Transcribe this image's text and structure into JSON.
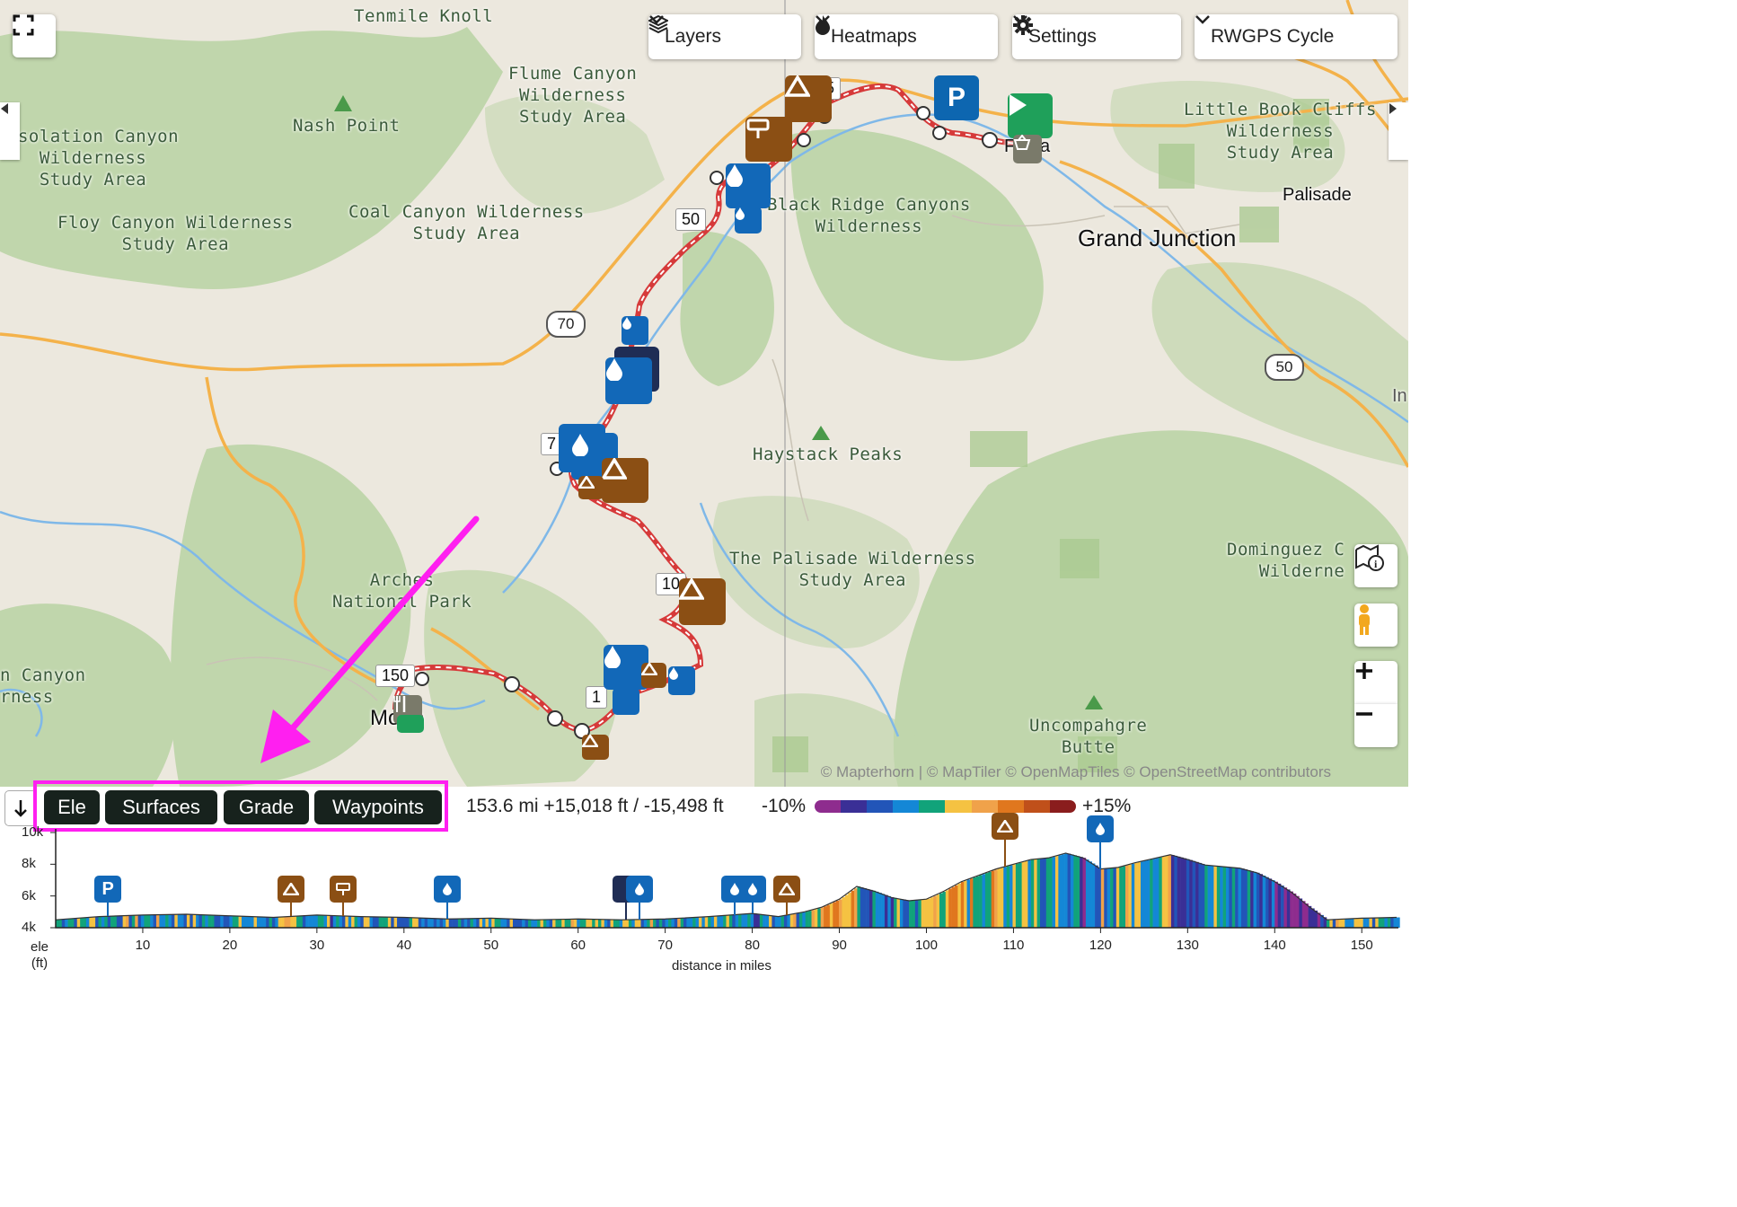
{
  "toolbar": {
    "layers_label": "Layers",
    "heatmaps_label": "Heatmaps",
    "settings_label": "Settings",
    "basemap_label": "RWGPS Cycle"
  },
  "map_labels": {
    "tenmile": "Tenmile Knoll",
    "flume": "Flume Canyon\nWilderness\nStudy Area",
    "nash": "Nash Point",
    "desolation": "esolation Canyon\nWilderness\nStudy Area",
    "floy": "Floy Canyon Wilderness\nStudy Area",
    "coal": "Coal Canyon Wilderness\nStudy Area",
    "blackridge": "Black Ridge Canyons\nWilderness",
    "littlebook": "Little Book Cliffs\nWilderness\nStudy Area",
    "palisade": "Palisade",
    "grandjunction": "Grand Junction",
    "haystack": "Haystack Peaks",
    "palisadewild": "The Palisade Wilderness\nStudy Area",
    "dominguez": "Dominguez C\nWilderne",
    "arches": "Arches\nNational Park",
    "canyon": "n Canyon\nrness",
    "uncompahgre": "Uncompahgre\nButte",
    "moab": "Moab",
    "fruita": "Fruita",
    "in": "In"
  },
  "shields": {
    "i70": "70",
    "us50": "50"
  },
  "mile_markers": {
    "m50": "50",
    "m75": "7",
    "m100": "10",
    "m150": "150",
    "m125": "1",
    "m25": "5"
  },
  "attribution": "© Mapterhorn | © MapTiler © OpenMapTiles © OpenStreetMap contributors",
  "tabs": {
    "ele": "Ele",
    "surfaces": "Surfaces",
    "grade": "Grade",
    "waypoints": "Waypoints"
  },
  "stats": "153.6 mi +15,018 ft / -15,498 ft",
  "grade_legend": {
    "min": "-10%",
    "max": "+15%",
    "colors": [
      "#8e2c8e",
      "#3a2f96",
      "#2255b8",
      "#1487d6",
      "#11a37a",
      "#f5c242",
      "#f0a24a",
      "#e0771e",
      "#c0501a",
      "#8a1d1d"
    ]
  },
  "chart_data": {
    "type": "area",
    "title": "",
    "xlabel": "distance in miles",
    "ylabel": "ele\n(ft)",
    "xlim": [
      0,
      154
    ],
    "ylim": [
      4000,
      10000
    ],
    "x_ticks": [
      "10",
      "20",
      "30",
      "40",
      "50",
      "60",
      "70",
      "80",
      "90",
      "100",
      "110",
      "120",
      "130",
      "140",
      "150"
    ],
    "y_ticks": [
      "10k",
      "8k",
      "6k",
      "4k"
    ],
    "x": [
      0,
      5,
      10,
      15,
      20,
      25,
      30,
      35,
      40,
      45,
      50,
      55,
      60,
      65,
      70,
      75,
      80,
      83,
      86,
      88,
      90,
      92,
      94,
      96,
      98,
      100,
      102,
      104,
      106,
      108,
      110,
      112,
      114,
      116,
      118,
      120,
      122,
      124,
      126,
      128,
      130,
      132,
      134,
      136,
      138,
      140,
      142,
      144,
      146,
      150,
      154
    ],
    "y": [
      4500,
      4700,
      4800,
      4850,
      4750,
      4650,
      4800,
      4700,
      4650,
      4550,
      4600,
      4500,
      4550,
      4500,
      4550,
      4700,
      4900,
      4700,
      5000,
      5300,
      5800,
      6600,
      6300,
      5900,
      5700,
      5800,
      6300,
      6900,
      7300,
      7700,
      8000,
      8300,
      8400,
      8700,
      8400,
      7700,
      7800,
      8100,
      8350,
      8600,
      8300,
      7950,
      7850,
      7750,
      7450,
      6900,
      6200,
      5300,
      4500,
      4600,
      4650
    ],
    "waypoints": [
      {
        "mile": 6,
        "icon": "parking"
      },
      {
        "mile": 27,
        "icon": "camping"
      },
      {
        "mile": 33,
        "icon": "sign"
      },
      {
        "mile": 45,
        "icon": "water"
      },
      {
        "mile": 65.5,
        "icon": "food"
      },
      {
        "mile": 67,
        "icon": "water"
      },
      {
        "mile": 78,
        "icon": "water"
      },
      {
        "mile": 80,
        "icon": "water"
      },
      {
        "mile": 84,
        "icon": "camping"
      },
      {
        "mile": 109,
        "icon": "camping"
      },
      {
        "mile": 120,
        "icon": "water"
      }
    ]
  }
}
